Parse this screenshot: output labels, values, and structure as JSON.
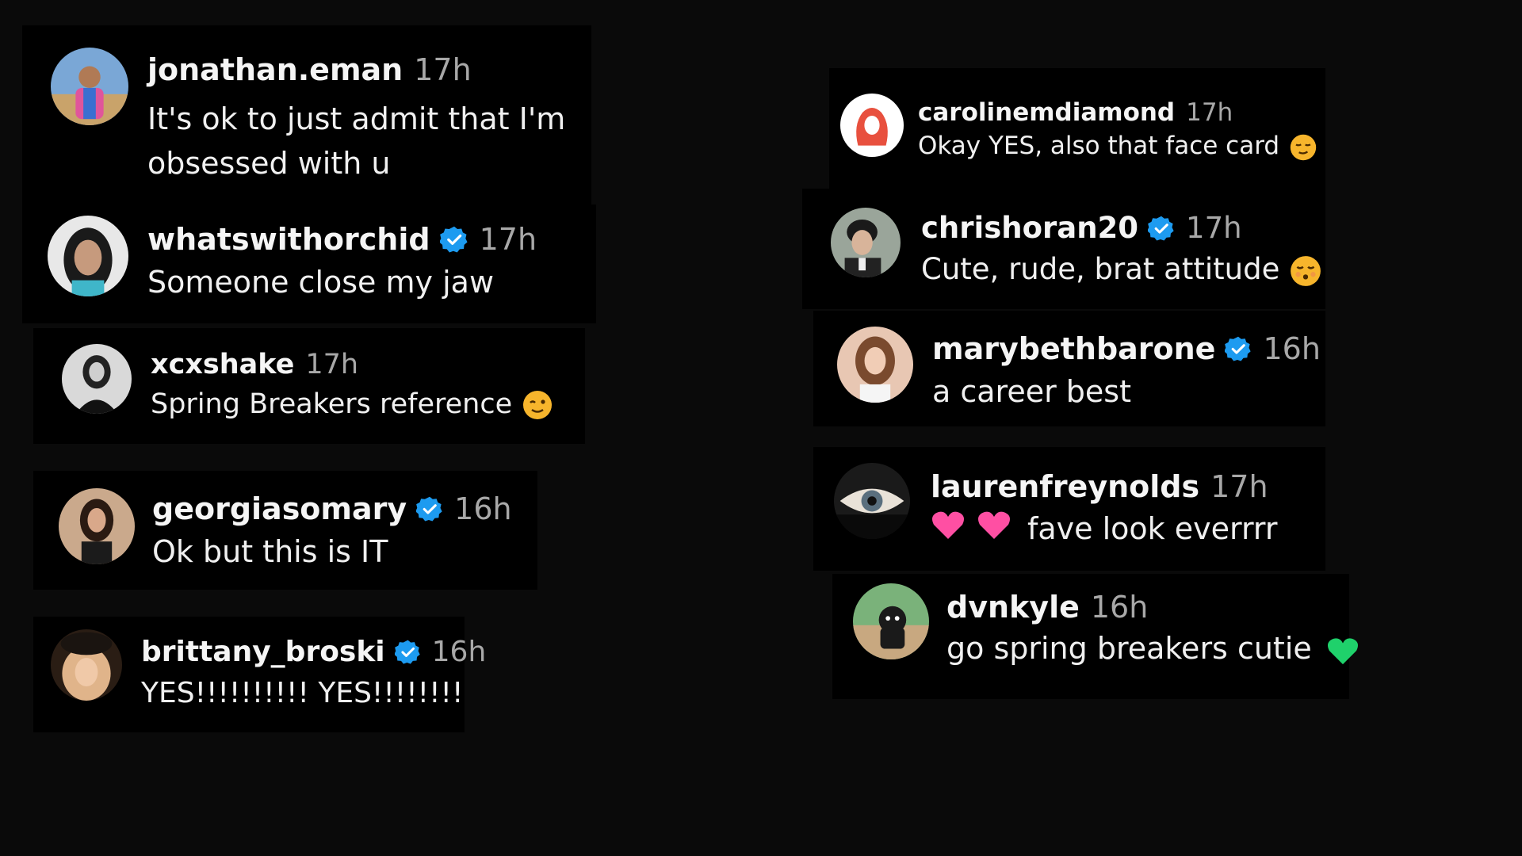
{
  "comments_left": [
    {
      "username": "jonathan.eman",
      "verified": false,
      "time": "17h",
      "lines": [
        "It's ok to just admit that I'm",
        "obsessed with u"
      ]
    },
    {
      "username": "whatswithorchid",
      "verified": true,
      "time": "17h",
      "lines": [
        "Someone close my jaw"
      ]
    },
    {
      "username": "xcxshake",
      "verified": false,
      "time": "17h",
      "lines": [
        "Spring Breakers reference"
      ],
      "emoji": "winking-face-emoji"
    },
    {
      "username": "georgiasomary",
      "verified": true,
      "time": "16h",
      "lines": [
        "Ok but this is IT"
      ]
    },
    {
      "username": "brittany_broski",
      "verified": true,
      "time": "16h",
      "lines": [
        "YES!!!!!!!!!! YES!!!!!!!!"
      ]
    }
  ],
  "comments_right": [
    {
      "username": "carolinemdiamond",
      "verified": false,
      "time": "17h",
      "lines": [
        "Okay YES, also that face card"
      ],
      "emoji": "smirking-face-emoji"
    },
    {
      "username": "chrishoran20",
      "verified": true,
      "time": "17h",
      "lines": [
        "Cute, rude, brat attitude"
      ],
      "emoji": "kissing-face-emoji"
    },
    {
      "username": "marybethbarone",
      "verified": true,
      "time": "16h",
      "lines": [
        "a career best"
      ]
    },
    {
      "username": "laurenfreynolds",
      "verified": false,
      "time": "17h",
      "lines": [
        "fave look everrrr"
      ],
      "emoji_prefix": [
        "pink-heart-emoji",
        "pink-heart-emoji"
      ]
    },
    {
      "username": "dvnkyle",
      "verified": false,
      "time": "16h",
      "lines": [
        "go spring breakers cutie"
      ],
      "emoji": "green-heart-emoji"
    }
  ],
  "colors": {
    "background": "#0a0a0a",
    "card": "#000000",
    "verified_blue": "#1d9bf0",
    "time_gray": "#a8a8a8",
    "pink_heart": "#ff4fa3",
    "green_heart": "#1fd16b",
    "emoji_yellow": "#f7b52c"
  }
}
